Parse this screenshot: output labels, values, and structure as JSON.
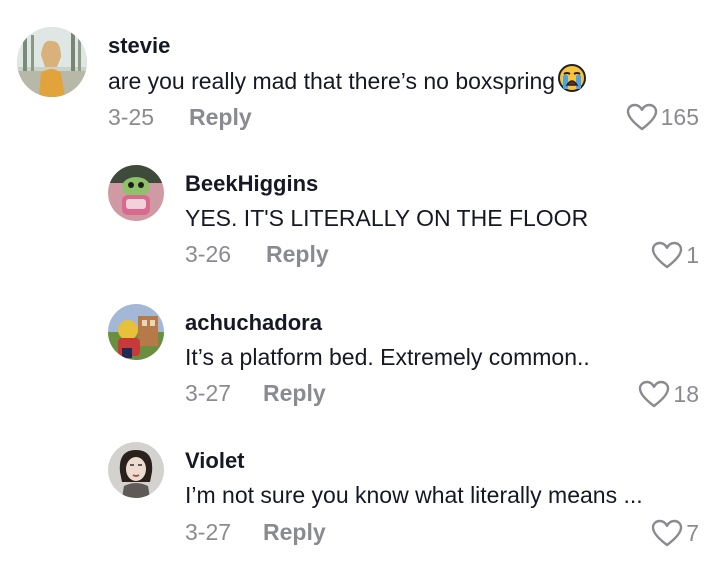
{
  "comments": [
    {
      "username": "stevie",
      "text": "are you really mad that there’s no boxspring",
      "emoji": "loudly-crying-face",
      "date": "3-25",
      "reply_label": "Reply",
      "likes": "165"
    },
    {
      "username": "BeekHiggins",
      "text": "YES. IT'S LITERALLY ON THE FLOOR",
      "date": "3-26",
      "reply_label": "Reply",
      "likes": "1"
    },
    {
      "username": "achuchadora",
      "text": "It’s a platform bed. Extremely common..",
      "date": "3-27",
      "reply_label": "Reply",
      "likes": "18"
    },
    {
      "username": "Violet",
      "text": "I’m not sure you know what literally means ...",
      "date": "3-27",
      "reply_label": "Reply",
      "likes": "7"
    }
  ],
  "colors": {
    "text": "#161823",
    "muted": "#8a8b91"
  }
}
